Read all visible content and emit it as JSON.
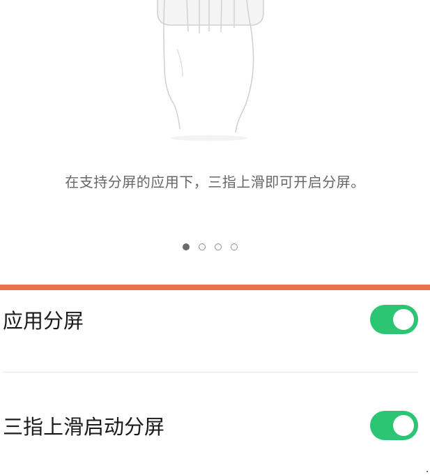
{
  "guide": {
    "illustration_icon": "three-finger-swipe-hand",
    "hint_text": "在支持分屏的应用下，三指上滑即可开启分屏。",
    "page_indicator": {
      "total": 4,
      "current": 1
    }
  },
  "settings": {
    "items": [
      {
        "label": "应用分屏",
        "enabled": true
      },
      {
        "label": "三指上滑启动分屏",
        "enabled": true
      }
    ]
  },
  "colors": {
    "accent_bar": "#e8704a",
    "toggle_on": "#2bc574",
    "text_primary": "#1a1a1a",
    "text_secondary": "#666666"
  }
}
